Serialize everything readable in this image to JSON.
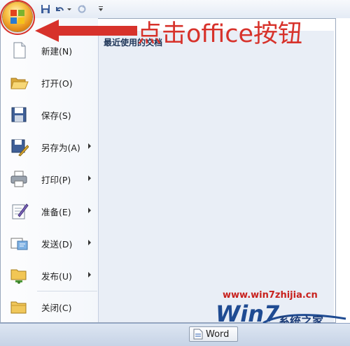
{
  "annotation": {
    "text": "点击office按钮"
  },
  "menu": {
    "recent_title": "最近使用的文档",
    "items": [
      {
        "label": "新建(N)",
        "icon": "new-document-icon",
        "submenu": false
      },
      {
        "label": "打开(O)",
        "icon": "open-folder-icon",
        "submenu": false
      },
      {
        "label": "保存(S)",
        "icon": "save-floppy-icon",
        "submenu": false
      },
      {
        "label": "另存为(A)",
        "icon": "save-as-icon",
        "submenu": true
      },
      {
        "label": "打印(P)",
        "icon": "printer-icon",
        "submenu": true
      },
      {
        "label": "准备(E)",
        "icon": "prepare-icon",
        "submenu": true
      },
      {
        "label": "发送(D)",
        "icon": "send-icon",
        "submenu": true
      },
      {
        "label": "发布(U)",
        "icon": "publish-icon",
        "submenu": true
      },
      {
        "label": "关闭(C)",
        "icon": "close-folder-icon",
        "submenu": false
      }
    ]
  },
  "taskbar": {
    "word_label": "Word"
  },
  "watermark": {
    "url": "www.win7zhijia.cn",
    "name": "系统之家",
    "logo": "Win7"
  },
  "colors": {
    "annotation": "#d7322b",
    "menu_right_bg": "#e9eef6",
    "orb": "#f2a12b"
  }
}
